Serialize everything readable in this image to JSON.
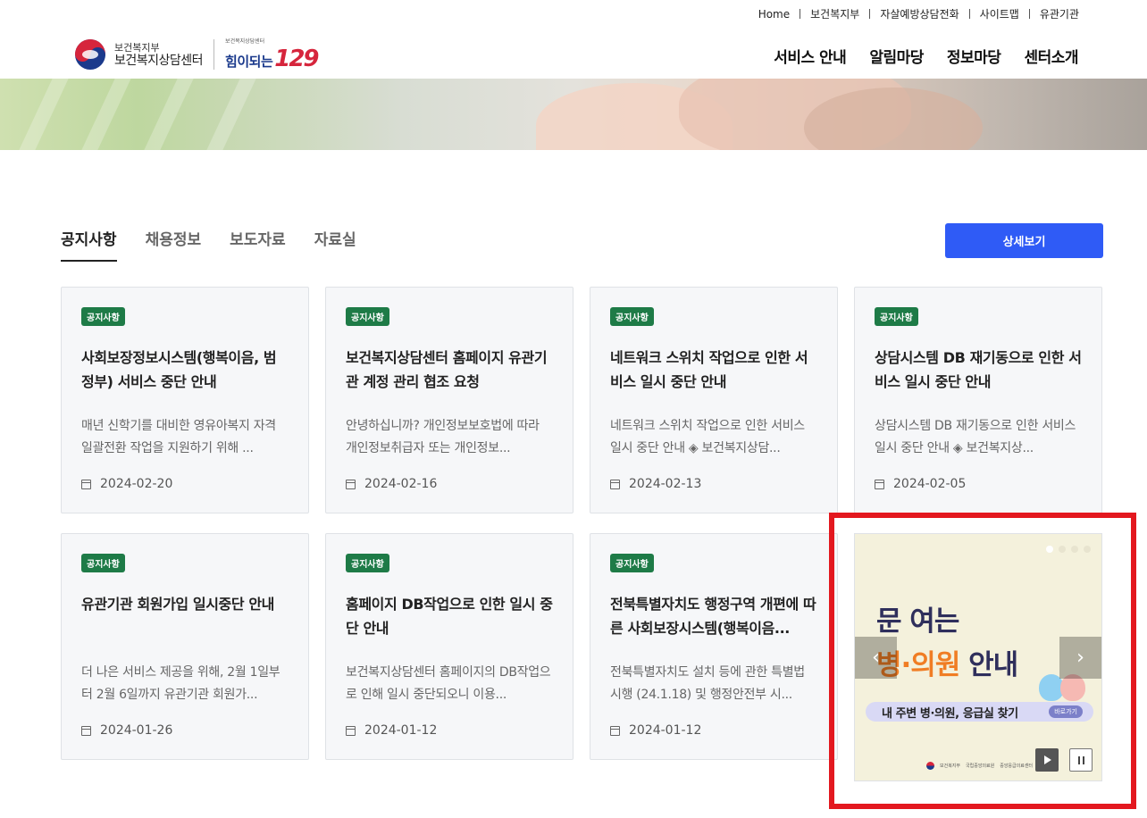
{
  "util_nav": [
    "Home",
    "보건복지부",
    "자살예방상담전화",
    "사이트맵",
    "유관기관"
  ],
  "logo": {
    "ministry": "보건복지부",
    "center": "보건복지상담센터",
    "brand_small": "보건복지상담센터",
    "brand_text": "힘이되는",
    "brand_number": "129"
  },
  "gnb": [
    "서비스 안내",
    "알림마당",
    "정보마당",
    "센터소개"
  ],
  "tabs": [
    "공지사항",
    "채용정보",
    "보도자료",
    "자료실"
  ],
  "more_button": "상세보기",
  "cards": [
    {
      "badge": "공지사항",
      "title": "사회보장정보시스템(행복이음, 범정부) 서비스 중단 안내",
      "excerpt": "매년 신학기를 대비한 영유아복지 자격 일괄전환 작업을 지원하기 위해 ...",
      "date": "2024-02-20"
    },
    {
      "badge": "공지사항",
      "title": "보건복지상담센터 홈페이지 유관기관 계정 관리 협조 요청",
      "excerpt": "안녕하십니까? 개인정보보호법에 따라 개인정보취급자 또는 개인정보...",
      "date": "2024-02-16"
    },
    {
      "badge": "공지사항",
      "title": "네트워크 스위치 작업으로 인한 서비스 일시 중단 안내",
      "excerpt": "네트워크 스위치 작업으로 인한 서비스 일시 중단 안내 ◈ 보건복지상담...",
      "date": "2024-02-13"
    },
    {
      "badge": "공지사항",
      "title": "상담시스템 DB 재기동으로 인한 서비스 일시 중단 안내",
      "excerpt": "상담시스템 DB 재기동으로 인한 서비스 일시 중단 안내 ◈ 보건복지상...",
      "date": "2024-02-05"
    },
    {
      "badge": "공지사항",
      "title": "유관기관 회원가입 일시중단 안내",
      "excerpt": "더 나은 서비스 제공을 위해, 2월 1일부터 2월 6일까지 유관기관 회원가...",
      "date": "2024-01-26"
    },
    {
      "badge": "공지사항",
      "title": "홈페이지 DB작업으로 인한 일시 중단 안내",
      "excerpt": "보건복지상담센터 홈페이지의 DB작업으로 인해 일시 중단되오니 이용...",
      "date": "2024-01-12"
    },
    {
      "badge": "공지사항",
      "title": "전북특별자치도 행정구역 개편에 따른 사회보장시스템(행복이음...",
      "excerpt": "전북특별자치도 설치 등에 관한 특별법 시행 (24.1.18) 및 행정안전부 시...",
      "date": "2024-01-12"
    }
  ],
  "banner": {
    "line1": "문 여는",
    "line2_accent": "병·의원",
    "line2_rest": " 안내",
    "pill_text": "내 주변 병·의원, 응급실 찾기",
    "pill_button": "바로가기",
    "prev_icon": "chevron-left-icon",
    "next_icon": "chevron-right-icon",
    "prev_glyph": "‹",
    "next_glyph": "›",
    "slides_total": 4,
    "slide_active": 1,
    "footer_org1": "보건복지부",
    "footer_org2": "국립중앙의료원",
    "footer_org3": "중앙응급의료센터"
  },
  "colors": {
    "primary_button": "#2f5bf6",
    "badge": "#1e7b47",
    "highlight_border": "#e3181f",
    "banner_accent": "#f07d24"
  }
}
